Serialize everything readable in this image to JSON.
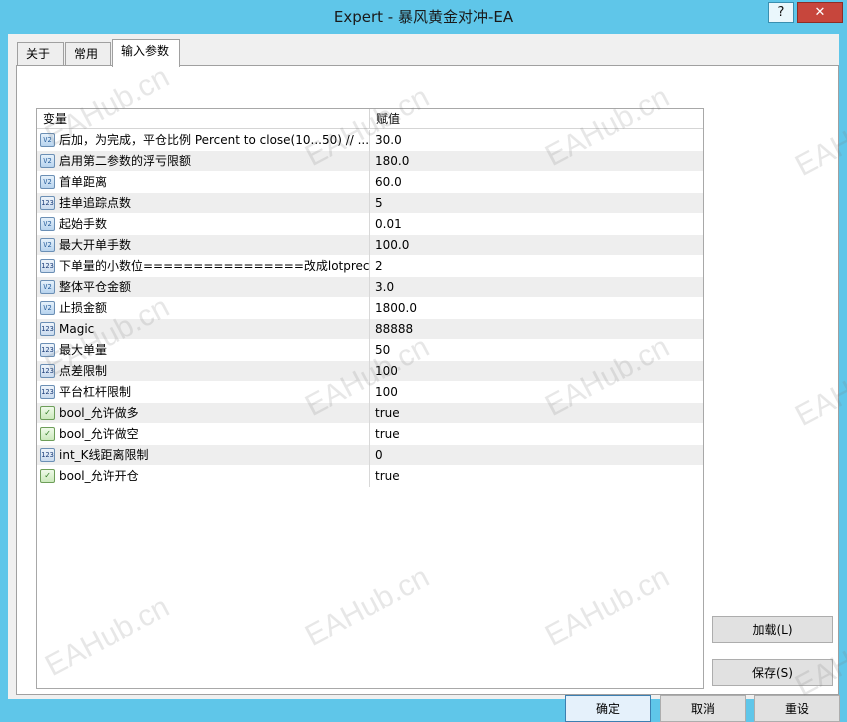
{
  "window": {
    "title": "Expert - 暴风黄金对冲-EA",
    "help_label": "?",
    "close_label": "✕"
  },
  "tabs": [
    {
      "label": "关于",
      "active": false
    },
    {
      "label": "常用",
      "active": false
    },
    {
      "label": "输入参数",
      "active": true
    }
  ],
  "table": {
    "columns": [
      "变量",
      "赋值"
    ],
    "rows": [
      {
        "type": "double",
        "icon": "V2",
        "name": "后加，为完成，平仓比例 Percent to close(10...50) // ...",
        "value": "30.0"
      },
      {
        "type": "double",
        "icon": "V2",
        "name": "启用第二参数的浮亏限额",
        "value": "180.0"
      },
      {
        "type": "double",
        "icon": "V2",
        "name": "首单距离",
        "value": "60.0"
      },
      {
        "type": "int",
        "icon": "123",
        "name": "挂单追踪点数",
        "value": "5"
      },
      {
        "type": "double",
        "icon": "V2",
        "name": "起始手数",
        "value": "0.01"
      },
      {
        "type": "double",
        "icon": "V2",
        "name": "最大开单手数",
        "value": "100.0"
      },
      {
        "type": "int",
        "icon": "123",
        "name": "下单量的小数位================改成lotpreci...",
        "value": "2"
      },
      {
        "type": "double",
        "icon": "V2",
        "name": "整体平仓金额",
        "value": "3.0"
      },
      {
        "type": "double",
        "icon": "V2",
        "name": "止损金额",
        "value": "1800.0"
      },
      {
        "type": "int",
        "icon": "123",
        "name": "Magic",
        "value": "88888"
      },
      {
        "type": "int",
        "icon": "123",
        "name": "最大单量",
        "value": "50"
      },
      {
        "type": "int",
        "icon": "123",
        "name": "点差限制",
        "value": "100"
      },
      {
        "type": "int",
        "icon": "123",
        "name": "平台杠杆限制",
        "value": "100"
      },
      {
        "type": "bool",
        "icon": "✓",
        "name": "bool_允许做多",
        "value": "true"
      },
      {
        "type": "bool",
        "icon": "✓",
        "name": "bool_允许做空",
        "value": "true"
      },
      {
        "type": "int",
        "icon": "123",
        "name": "int_K线距离限制",
        "value": "0"
      },
      {
        "type": "bool",
        "icon": "✓",
        "name": "bool_允许开仓",
        "value": "true"
      }
    ]
  },
  "buttons": {
    "load": "加载(L)",
    "save": "保存(S)",
    "ok": "确定",
    "cancel": "取消",
    "reset": "重设"
  },
  "watermark": "EAHub.cn",
  "colors": {
    "title_bar": "#5fc6e9",
    "close_button": "#c7463c",
    "row_alt": "#eeeeee"
  }
}
